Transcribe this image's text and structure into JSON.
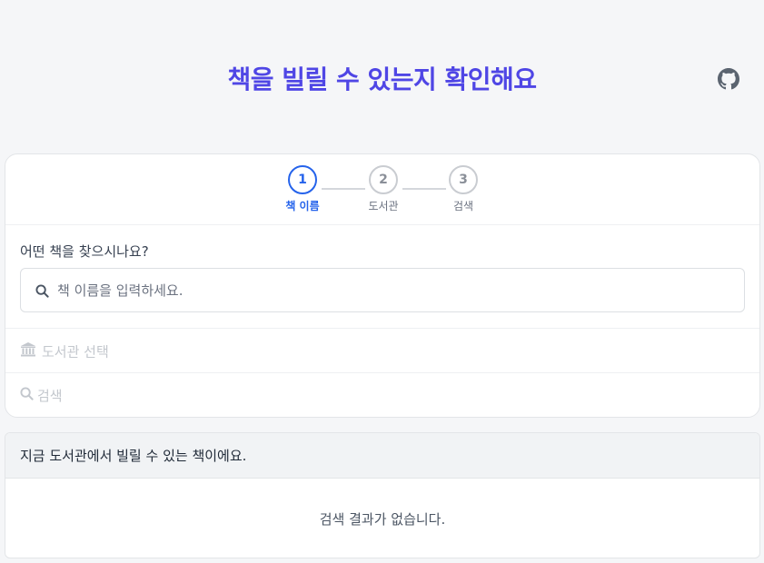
{
  "header": {
    "title": "책을 빌릴 수 있는지 확인해요",
    "github_icon": "github-icon",
    "title_color": "#4f46e5"
  },
  "stepper": {
    "steps": [
      {
        "number": "1",
        "label": "책 이름",
        "state": "active"
      },
      {
        "number": "2",
        "label": "도서관",
        "state": "inactive"
      },
      {
        "number": "3",
        "label": "검색",
        "state": "inactive"
      }
    ],
    "active_color": "#2563eb"
  },
  "book_step": {
    "question": "어떤 책을 찾으시나요?",
    "search_placeholder": "책 이름을 입력하세요.",
    "search_value": "",
    "icon": "search-icon"
  },
  "library_step": {
    "label": "도서관 선택",
    "icon": "bank-icon"
  },
  "search_step": {
    "label": "검색",
    "icon": "search-icon"
  },
  "results": {
    "heading": "지금 도서관에서 빌릴 수 있는 책이에요.",
    "empty_message": "검색 결과가 없습니다."
  }
}
